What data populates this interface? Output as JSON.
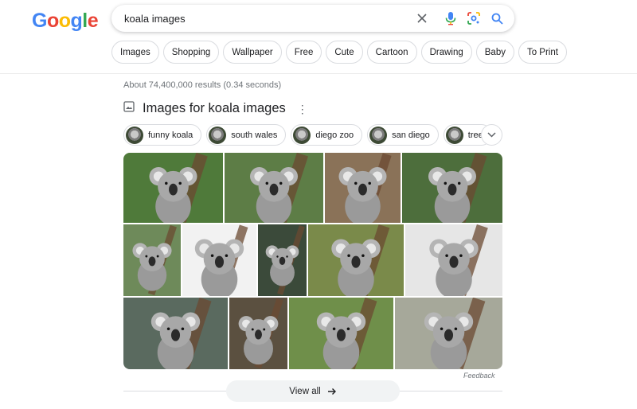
{
  "logo": {
    "letters": [
      "G",
      "o",
      "o",
      "g",
      "l",
      "e"
    ],
    "colors": [
      "#4285F4",
      "#EA4335",
      "#FBBC05",
      "#4285F4",
      "#34A853",
      "#EA4335"
    ]
  },
  "search": {
    "query": "koala images",
    "icons": [
      "clear-icon",
      "mic-icon",
      "lens-icon",
      "search-icon"
    ]
  },
  "filters": [
    "Images",
    "Shopping",
    "Wallpaper",
    "Free",
    "Cute",
    "Cartoon",
    "Drawing",
    "Baby",
    "To Print"
  ],
  "results_count": "About 74,400,000 results (0.34 seconds)",
  "images_section": {
    "title": "Images for koala images",
    "refinements": [
      "funny koala",
      "south wales",
      "diego zoo",
      "san diego",
      "tree"
    ],
    "feedback": "Feedback",
    "view_all": "View all"
  }
}
